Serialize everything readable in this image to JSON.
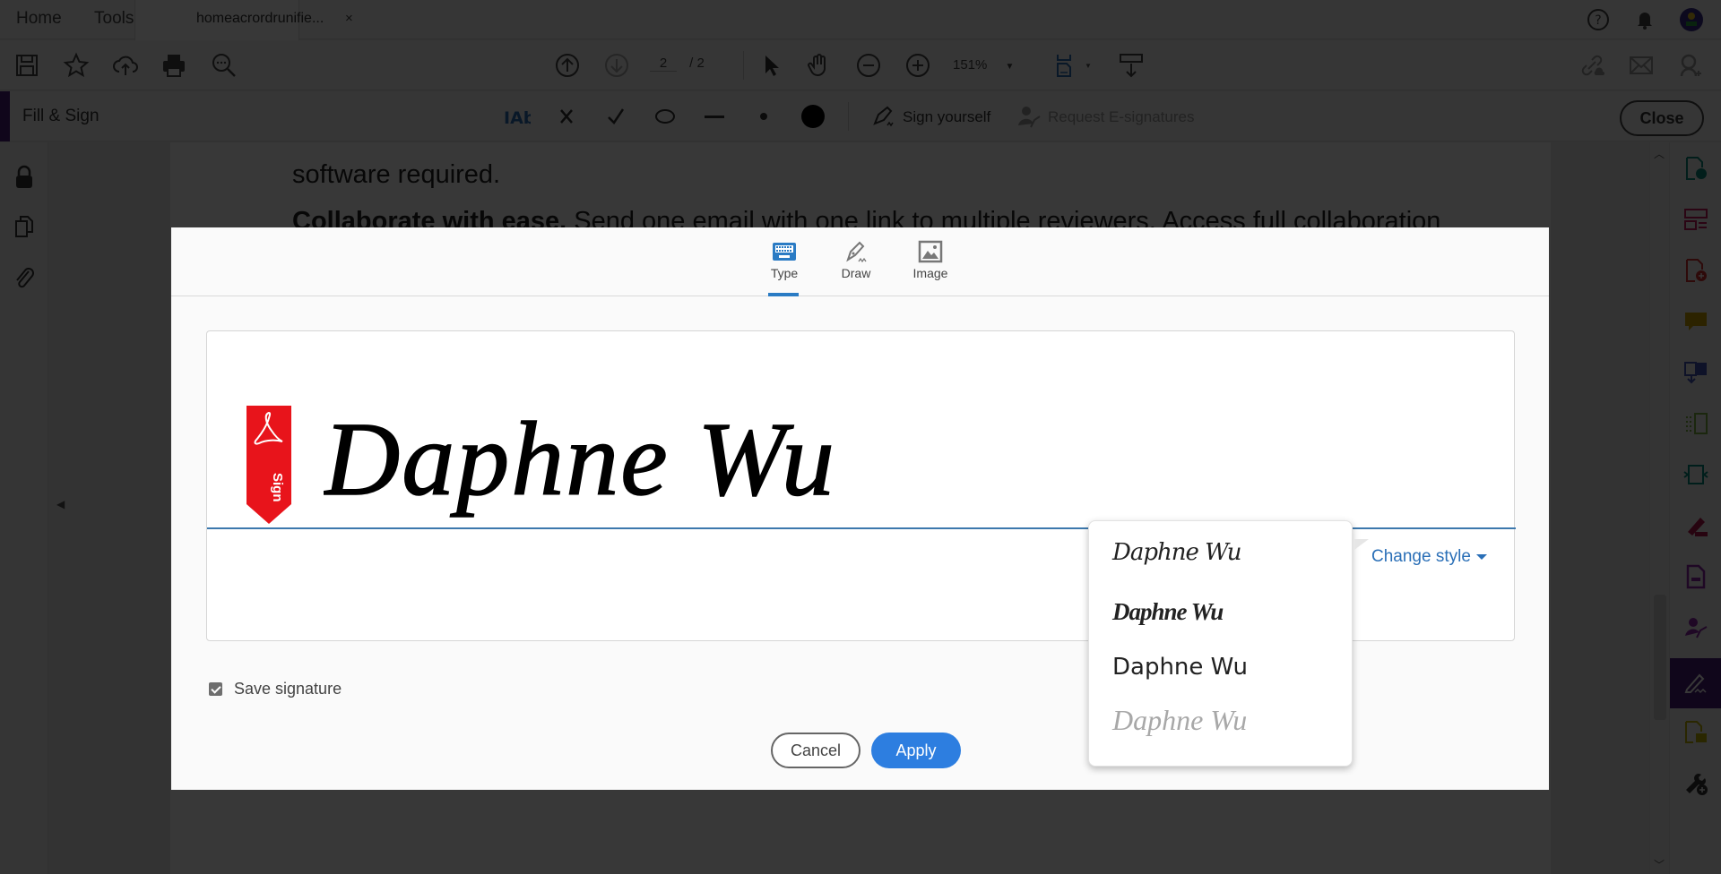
{
  "menubar": {
    "home_label": "Home",
    "tools_label": "Tools",
    "document_tab": "homeacrordrunifie...",
    "close_tab_glyph": "×",
    "icons": [
      "help-icon",
      "notification-bell-icon",
      "user-avatar"
    ]
  },
  "toolbar": {
    "icons": [
      "save-icon",
      "bookmark-star-icon",
      "upload-cloud-icon",
      "print-icon",
      "find-icon",
      "previous-page-icon",
      "next-page-icon",
      "select-cursor-icon",
      "hand-tool-icon",
      "zoom-out-icon",
      "zoom-in-icon",
      "fit-page-icon",
      "scroll-mode-icon",
      "share-link-icon",
      "email-icon",
      "add-user-icon"
    ],
    "current_page": "2",
    "total_pages": "/ 2",
    "zoom": "151%"
  },
  "fillsign": {
    "title": "Fill & Sign",
    "tools": [
      "add-text-icon",
      "cross-mark-icon",
      "checkmark-icon",
      "ellipse-icon",
      "line-icon",
      "dot-icon",
      "color-picker-icon"
    ],
    "sign_yourself": "Sign yourself",
    "request_esignatures": "Request E-signatures",
    "close": "Close"
  },
  "document": {
    "line1": "software required.",
    "line2_bold": "Collaborate with ease.",
    "line2_rest": " Send one email with one link to multiple reviewers. Access full collaboration"
  },
  "dialog": {
    "tabs": [
      {
        "label": "Type",
        "icon": "keyboard-icon",
        "active": true
      },
      {
        "label": "Draw",
        "icon": "pen-draw-icon",
        "active": false
      },
      {
        "label": "Image",
        "icon": "image-icon",
        "active": false
      }
    ],
    "signature_text": "Daphne Wu",
    "sign_tag_label": "Sign",
    "change_style": "Change style",
    "save_signature_label": "Save signature",
    "save_signature_checked": true,
    "cancel": "Cancel",
    "apply": "Apply",
    "style_options": [
      "Daphne Wu",
      "Daphne Wu",
      "Daphne Wu",
      "Daphne Wu"
    ]
  },
  "colors": {
    "accent_blue": "#2d7ee0",
    "link_blue": "#2a6fb7",
    "fillsign_purple": "#4b1c7a",
    "adobe_red": "#e8141b"
  }
}
